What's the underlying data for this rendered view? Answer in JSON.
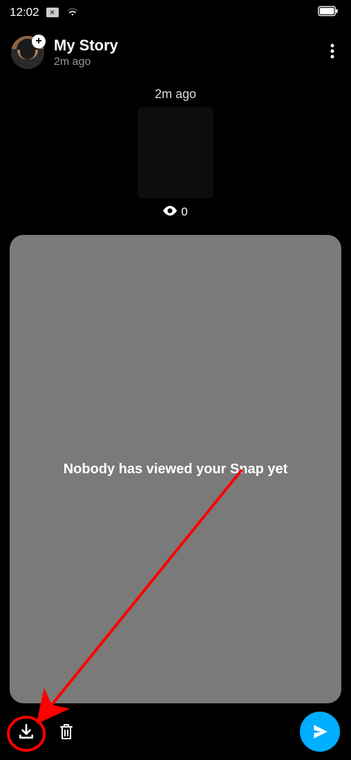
{
  "status": {
    "time": "12:02"
  },
  "header": {
    "title": "My Story",
    "subtitle": "2m ago"
  },
  "preview": {
    "time": "2m ago",
    "views": "0"
  },
  "panel": {
    "message": "Nobody has viewed your Snap yet"
  }
}
